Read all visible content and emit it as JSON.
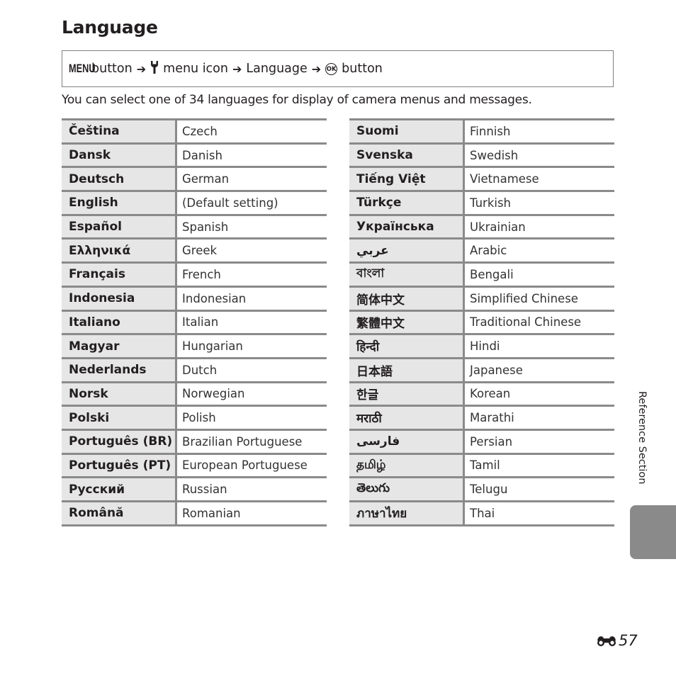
{
  "header": {
    "title": "Language"
  },
  "path": {
    "menu_word": "MENU",
    "step1": "button",
    "step2_icon": "wrench-icon",
    "step2": "menu icon",
    "step3": "Language",
    "step4_icon": "ok-button-icon",
    "ok_label": "OK",
    "step4": "button",
    "arrow": "➔",
    "wrench_glyph": "🔧"
  },
  "intro": "You can select one of 34 languages for display of camera menus and messages.",
  "tables": {
    "left": [
      {
        "native": "Čeština",
        "english": "Czech"
      },
      {
        "native": "Dansk",
        "english": "Danish"
      },
      {
        "native": "Deutsch",
        "english": "German"
      },
      {
        "native": "English",
        "english": "(Default setting)"
      },
      {
        "native": "Español",
        "english": "Spanish"
      },
      {
        "native": "Ελληνικά",
        "english": "Greek"
      },
      {
        "native": "Français",
        "english": "French"
      },
      {
        "native": "Indonesia",
        "english": "Indonesian"
      },
      {
        "native": "Italiano",
        "english": "Italian"
      },
      {
        "native": "Magyar",
        "english": "Hungarian"
      },
      {
        "native": "Nederlands",
        "english": "Dutch"
      },
      {
        "native": "Norsk",
        "english": "Norwegian"
      },
      {
        "native": "Polski",
        "english": "Polish"
      },
      {
        "native": "Português (BR)",
        "english": "Brazilian Portuguese"
      },
      {
        "native": "Português (PT)",
        "english": "European Portuguese"
      },
      {
        "native": "Русский",
        "english": "Russian"
      },
      {
        "native": "Română",
        "english": "Romanian"
      }
    ],
    "right": [
      {
        "native": "Suomi",
        "english": "Finnish"
      },
      {
        "native": "Svenska",
        "english": "Swedish"
      },
      {
        "native": "Tiếng Việt",
        "english": "Vietnamese"
      },
      {
        "native": "Türkçe",
        "english": "Turkish"
      },
      {
        "native": "Українська",
        "english": "Ukrainian"
      },
      {
        "native": "عربي",
        "english": "Arabic"
      },
      {
        "native": "বাংলা",
        "english": "Bengali"
      },
      {
        "native": "简体中文",
        "english": "Simplified Chinese"
      },
      {
        "native": "繁體中文",
        "english": "Traditional Chinese"
      },
      {
        "native": "हिन्दी",
        "english": "Hindi"
      },
      {
        "native": "日本語",
        "english": "Japanese"
      },
      {
        "native": "한글",
        "english": "Korean"
      },
      {
        "native": "मराठी",
        "english": "Marathi"
      },
      {
        "native": "فارسی",
        "english": "Persian"
      },
      {
        "native": "தமிழ்",
        "english": "Tamil"
      },
      {
        "native": "తెలుగు",
        "english": "Telugu"
      },
      {
        "native": "ภาษาไทย",
        "english": "Thai"
      }
    ]
  },
  "side_tab": {
    "label": "Reference Section"
  },
  "footer": {
    "page_icon": "binoculars-icon",
    "page_number": "57"
  }
}
